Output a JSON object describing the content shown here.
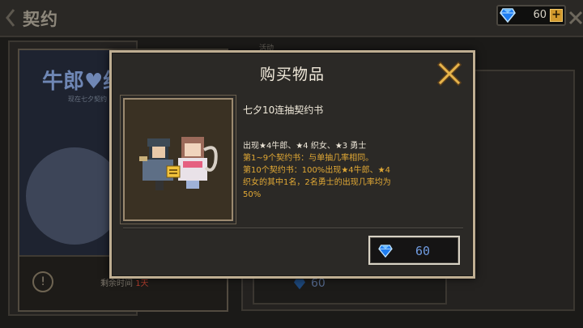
{
  "header": {
    "title": "契约",
    "currency_value": "60",
    "plus_label": "+"
  },
  "background": {
    "banner_title": "牛郎♥织女",
    "banner_subtitle": "现在七夕契约",
    "remaining_label": "剩余时间",
    "remaining_value": "1天",
    "tag": "活动",
    "price": "60"
  },
  "modal": {
    "title": "购买物品",
    "item_name": "七夕10连抽契约书",
    "desc_line1": "出现★4牛郎、★4 织女、★3 勇士",
    "desc_detail": [
      "第1~9个契约书：与单抽几率相同。",
      "第10个契约书：100%出现★4牛郎、★4",
      "织女的其中1名，2名勇士的出现几率均为",
      "50%"
    ],
    "price": "60"
  },
  "colors": {
    "accent_gold": "#e2a935",
    "price_blue": "#6f9be0",
    "gem_blue": "#2f8fff",
    "frame": "#bfae92"
  },
  "icons": {
    "close": "close-x-icon",
    "gem": "diamond-gem-icon",
    "back": "back-chevron-icon",
    "info": "info-icon"
  }
}
